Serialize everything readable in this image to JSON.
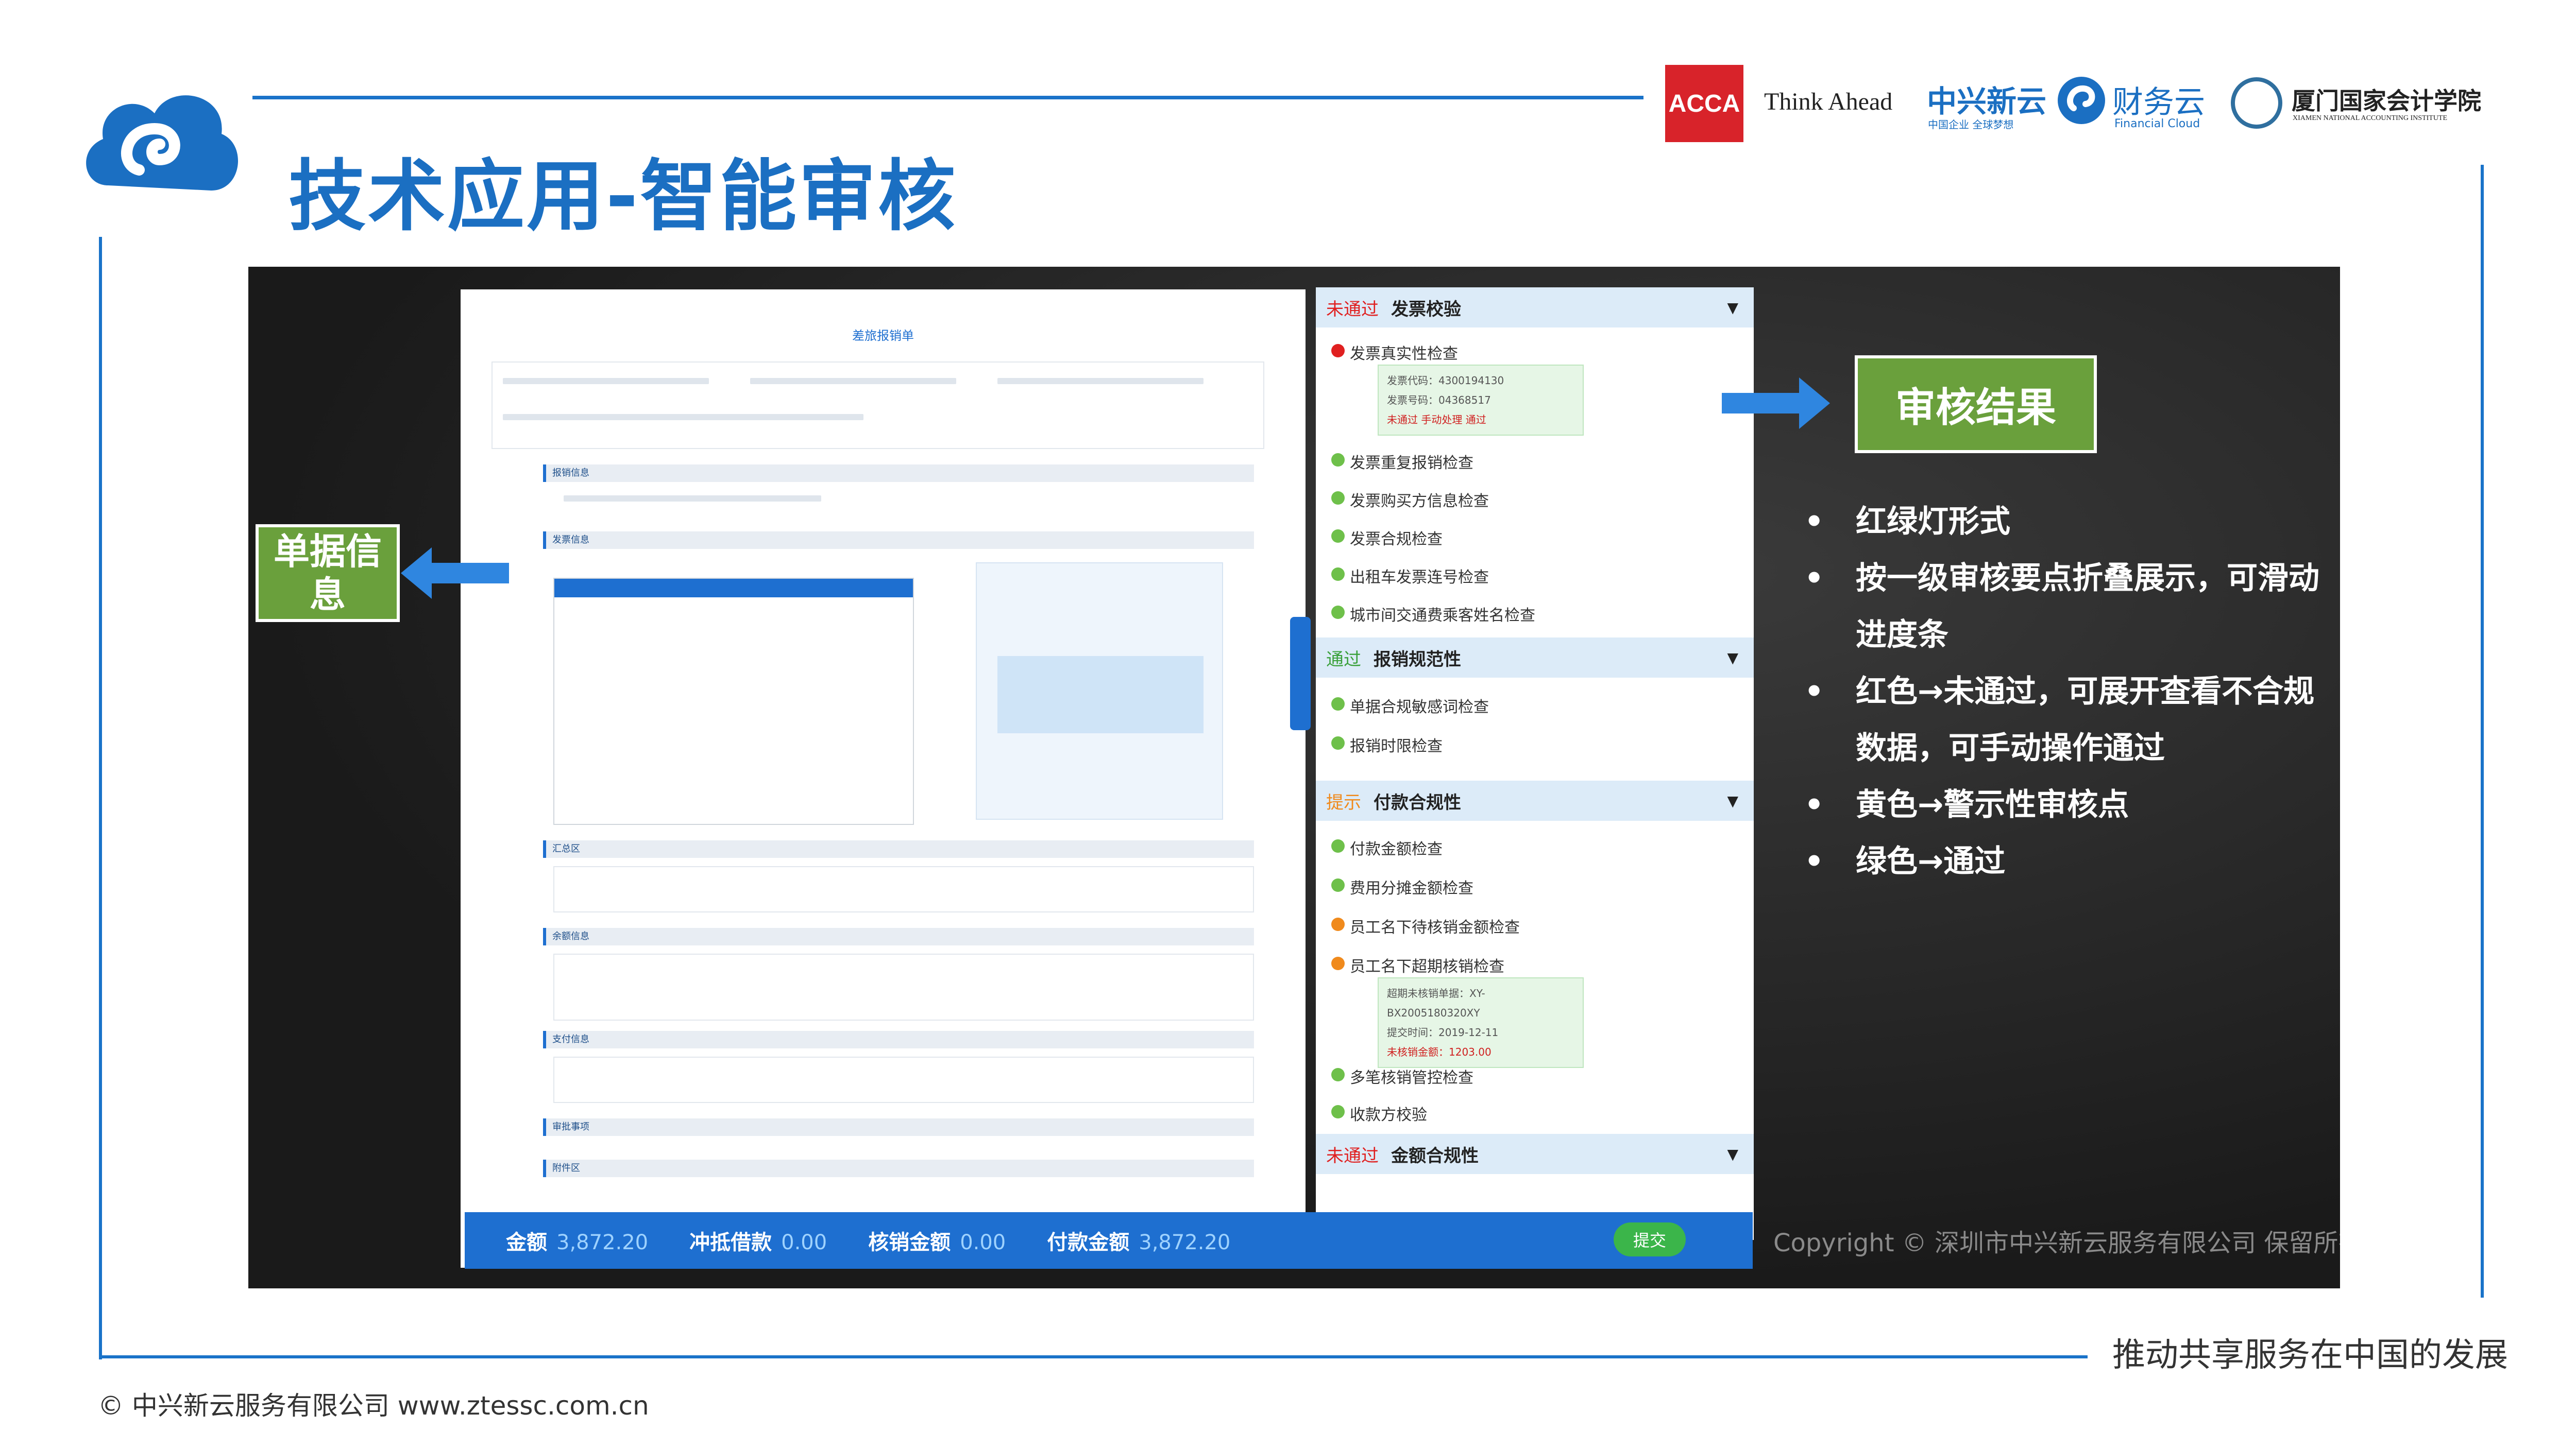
{
  "header": {
    "title": "技术应用-智能审核"
  },
  "logos": {
    "acca_mark": "ACCA",
    "acca_tagline": "Think Ahead",
    "zhongxing_name": "中兴新云",
    "zhongxing_sub": "中国企业 全球梦想",
    "caiwuyun_name": "财务云",
    "caiwuyun_sub": "Financial Cloud",
    "xiamen_name": "厦门国家会计学院",
    "xiamen_sub": "XIAMEN NATIONAL ACCOUNTING INSTITUTE"
  },
  "colors": {
    "brand_blue": "#1b6fc2",
    "label_green": "#6aa03c",
    "pass_green": "#6ec04a",
    "fail_red": "#e02020",
    "warn_orange": "#f08a1c"
  },
  "screenshot": {
    "doc_label": "单据信息",
    "result_label": "审核结果",
    "form_title": "差旅报销单",
    "sections": [
      "报销信息",
      "发票信息",
      "汇总区",
      "余额信息",
      "支付信息",
      "审批事项",
      "附件区"
    ],
    "bottom_bar": [
      {
        "label": "金额",
        "value": "3,872.20"
      },
      {
        "label": "冲抵借款",
        "value": "0.00"
      },
      {
        "label": "核销金额",
        "value": "0.00"
      },
      {
        "label": "付款金额",
        "value": "3,872.20"
      }
    ],
    "submit_label": "提交",
    "watermark": "Copyright © 深圳市中兴新云服务有限公司 保留所有权利"
  },
  "audit_groups": [
    {
      "status": "未通过",
      "status_color": "#e02020",
      "name": "发票校验",
      "items": [
        {
          "label": "发票真实性检查",
          "dot": "#e02020"
        },
        {
          "label": "发票重复报销检查",
          "dot": "#6ec04a"
        },
        {
          "label": "发票购买方信息检查",
          "dot": "#6ec04a"
        },
        {
          "label": "发票合规检查",
          "dot": "#6ec04a"
        },
        {
          "label": "出租车发票连号检查",
          "dot": "#6ec04a"
        },
        {
          "label": "城市间交通费乘客姓名检查",
          "dot": "#6ec04a"
        }
      ],
      "detail": [
        "发票代码：4300194130",
        "发票号码：04368517",
        "未通过  手动处理  通过"
      ]
    },
    {
      "status": "通过",
      "status_color": "#3aa03a",
      "name": "报销规范性",
      "items": [
        {
          "label": "单据合规敏感词检查",
          "dot": "#6ec04a"
        },
        {
          "label": "报销时限检查",
          "dot": "#6ec04a"
        }
      ]
    },
    {
      "status": "提示",
      "status_color": "#f08a1c",
      "name": "付款合规性",
      "items": [
        {
          "label": "付款金额检查",
          "dot": "#6ec04a"
        },
        {
          "label": "费用分摊金额检查",
          "dot": "#6ec04a"
        },
        {
          "label": "员工名下待核销金额检查",
          "dot": "#f08a1c"
        },
        {
          "label": "员工名下超期核销检查",
          "dot": "#f08a1c"
        },
        {
          "label": "多笔核销管控检查",
          "dot": "#6ec04a"
        },
        {
          "label": "收款方校验",
          "dot": "#6ec04a"
        }
      ],
      "detail": [
        "超期未核销单据：XY-BX2005180320XY",
        "提交时间：2019-12-11",
        "未核销金额：1203.00"
      ]
    },
    {
      "status": "未通过",
      "status_color": "#e02020",
      "name": "金额合规性",
      "items": []
    }
  ],
  "bullets": [
    "红绿灯形式",
    "按一级审核要点折叠展示，可滑动进度条",
    "红色→未通过，可展开查看不合规数据，可手动操作通过",
    "黄色→警示性审核点",
    "绿色→通过"
  ],
  "footer": {
    "tagline": "推动共享服务在中国的发展",
    "copyright": "© 中兴新云服务有限公司  www.ztessc.com.cn"
  }
}
